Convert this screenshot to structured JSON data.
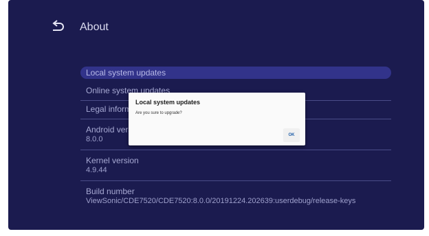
{
  "header": {
    "title": "About",
    "back_icon": "back-arrow-icon"
  },
  "settings": {
    "items": [
      {
        "label": "Local system updates"
      },
      {
        "label": "Online system updates"
      },
      {
        "label": "Legal information"
      },
      {
        "label": "Android version",
        "value": "8.0.0"
      },
      {
        "label": "Kernel version",
        "value": "4.9.44"
      },
      {
        "label": "Build number",
        "value": "ViewSonic/CDE7520/CDE7520:8.0.0/20191224.202639:userdebug/release-keys"
      }
    ]
  },
  "dialog": {
    "title": "Local system updates",
    "message": "Are you sure to upgrade?",
    "ok_label": "OK"
  },
  "colors": {
    "background": "#1b1b4f",
    "highlight": "#32338a",
    "text": "#a7a9d3",
    "dialog_button": "#1f5ea8"
  }
}
